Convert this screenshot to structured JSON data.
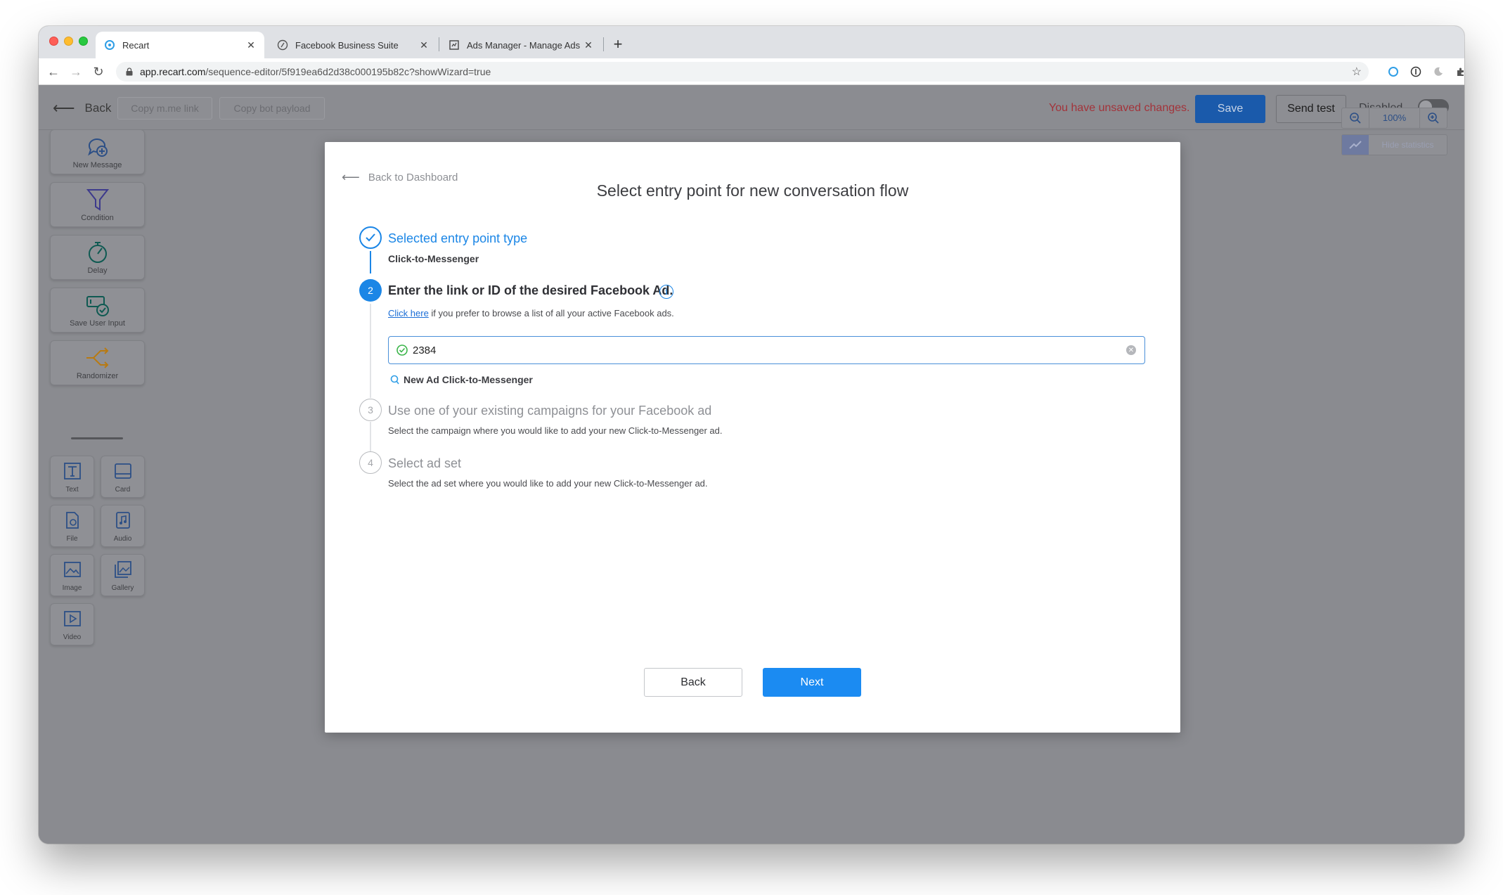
{
  "browser": {
    "tabs": [
      {
        "title": "Recart",
        "icon": "recart-icon",
        "active": true
      },
      {
        "title": "Facebook Business Suite",
        "icon": "facebook-business-icon",
        "active": false
      },
      {
        "title": "Ads Manager - Manage Ads - A",
        "icon": "ads-manager-icon",
        "active": false
      }
    ],
    "close_glyph": "✕",
    "new_tab_glyph": "+",
    "url_host": "app.recart.com",
    "url_path": "/sequence-editor/5f919ea6d2d38c000195b82c?showWizard=true"
  },
  "header": {
    "back_label": "Back",
    "copy_link_label": "Copy m.me link",
    "copy_payload_label": "Copy bot payload",
    "unsaved_text": "You have unsaved changes.",
    "save_label": "Save",
    "send_test_label": "Send test",
    "disabled_label": "Disabled"
  },
  "palette": {
    "big": [
      {
        "label": "New Message",
        "icon": "new-message-icon"
      },
      {
        "label": "Condition",
        "icon": "funnel-icon"
      },
      {
        "label": "Delay",
        "icon": "timer-icon"
      },
      {
        "label": "Save User Input",
        "icon": "save-input-icon"
      },
      {
        "label": "Randomizer",
        "icon": "split-icon"
      }
    ],
    "small": [
      {
        "label": "Text",
        "icon": "text-icon"
      },
      {
        "label": "Card",
        "icon": "card-icon"
      },
      {
        "label": "File",
        "icon": "file-icon"
      },
      {
        "label": "Audio",
        "icon": "audio-icon"
      },
      {
        "label": "Image",
        "icon": "image-icon"
      },
      {
        "label": "Gallery",
        "icon": "gallery-icon"
      },
      {
        "label": "Video",
        "icon": "video-icon"
      }
    ]
  },
  "zoom": {
    "value": "100%",
    "hide_stats_label": "Hide statistics"
  },
  "modal": {
    "back_to_dashboard": "Back to Dashboard",
    "title": "Select entry point for new conversation flow",
    "steps": [
      {
        "number": "1",
        "title": "Selected entry point type",
        "subtitle": "Click-to-Messenger",
        "state": "done"
      },
      {
        "number": "2",
        "title": "Enter the link or ID of the desired Facebook Ad.",
        "link_text": "Click here",
        "subtitle": " if you prefer to browse a list of all your active Facebook ads.",
        "state": "current"
      },
      {
        "number": "3",
        "title": "Use one of your existing campaigns for your Facebook ad",
        "subtitle": "Select the campaign where you would like to add your new Click-to-Messenger ad.",
        "state": "pending"
      },
      {
        "number": "4",
        "title": "Select ad set",
        "subtitle": "Select the ad set where you would like to add your new Click-to-Messenger ad.",
        "state": "pending"
      }
    ],
    "ad_input_value": "2384",
    "ad_result_label": "New Ad Click-to-Messenger",
    "back_button": "Back",
    "next_button": "Next"
  },
  "colors": {
    "accent": "#1b86e6",
    "save": "#1a5aab",
    "unsaved": "#a3333a"
  }
}
